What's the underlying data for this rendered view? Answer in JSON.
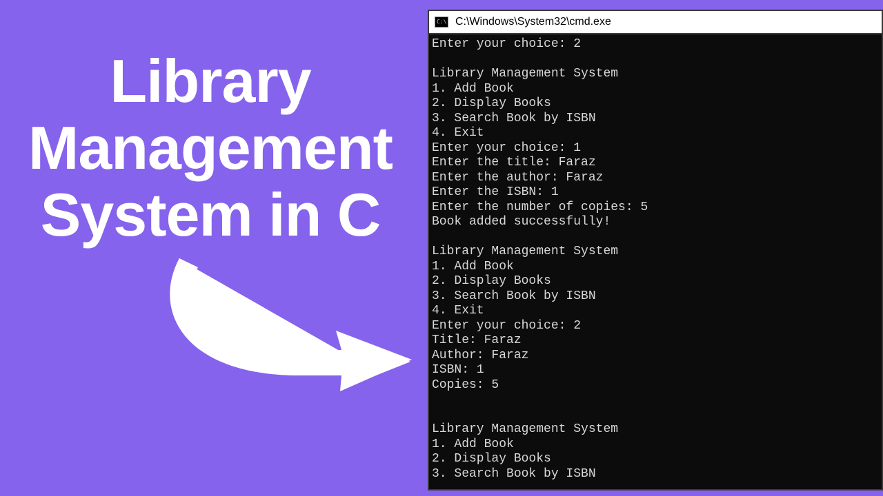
{
  "heading": {
    "line1": "Library",
    "line2": "Management",
    "line3": "System in C"
  },
  "console": {
    "title": "C:\\Windows\\System32\\cmd.exe",
    "icon_label": "C:\\",
    "lines": [
      "Enter your choice: 2",
      "",
      "Library Management System",
      "1. Add Book",
      "2. Display Books",
      "3. Search Book by ISBN",
      "4. Exit",
      "Enter your choice: 1",
      "Enter the title: Faraz",
      "Enter the author: Faraz",
      "Enter the ISBN: 1",
      "Enter the number of copies: 5",
      "Book added successfully!",
      "",
      "Library Management System",
      "1. Add Book",
      "2. Display Books",
      "3. Search Book by ISBN",
      "4. Exit",
      "Enter your choice: 2",
      "Title: Faraz",
      "Author: Faraz",
      "ISBN: 1",
      "Copies: 5",
      "",
      "",
      "Library Management System",
      "1. Add Book",
      "2. Display Books",
      "3. Search Book by ISBN"
    ]
  }
}
